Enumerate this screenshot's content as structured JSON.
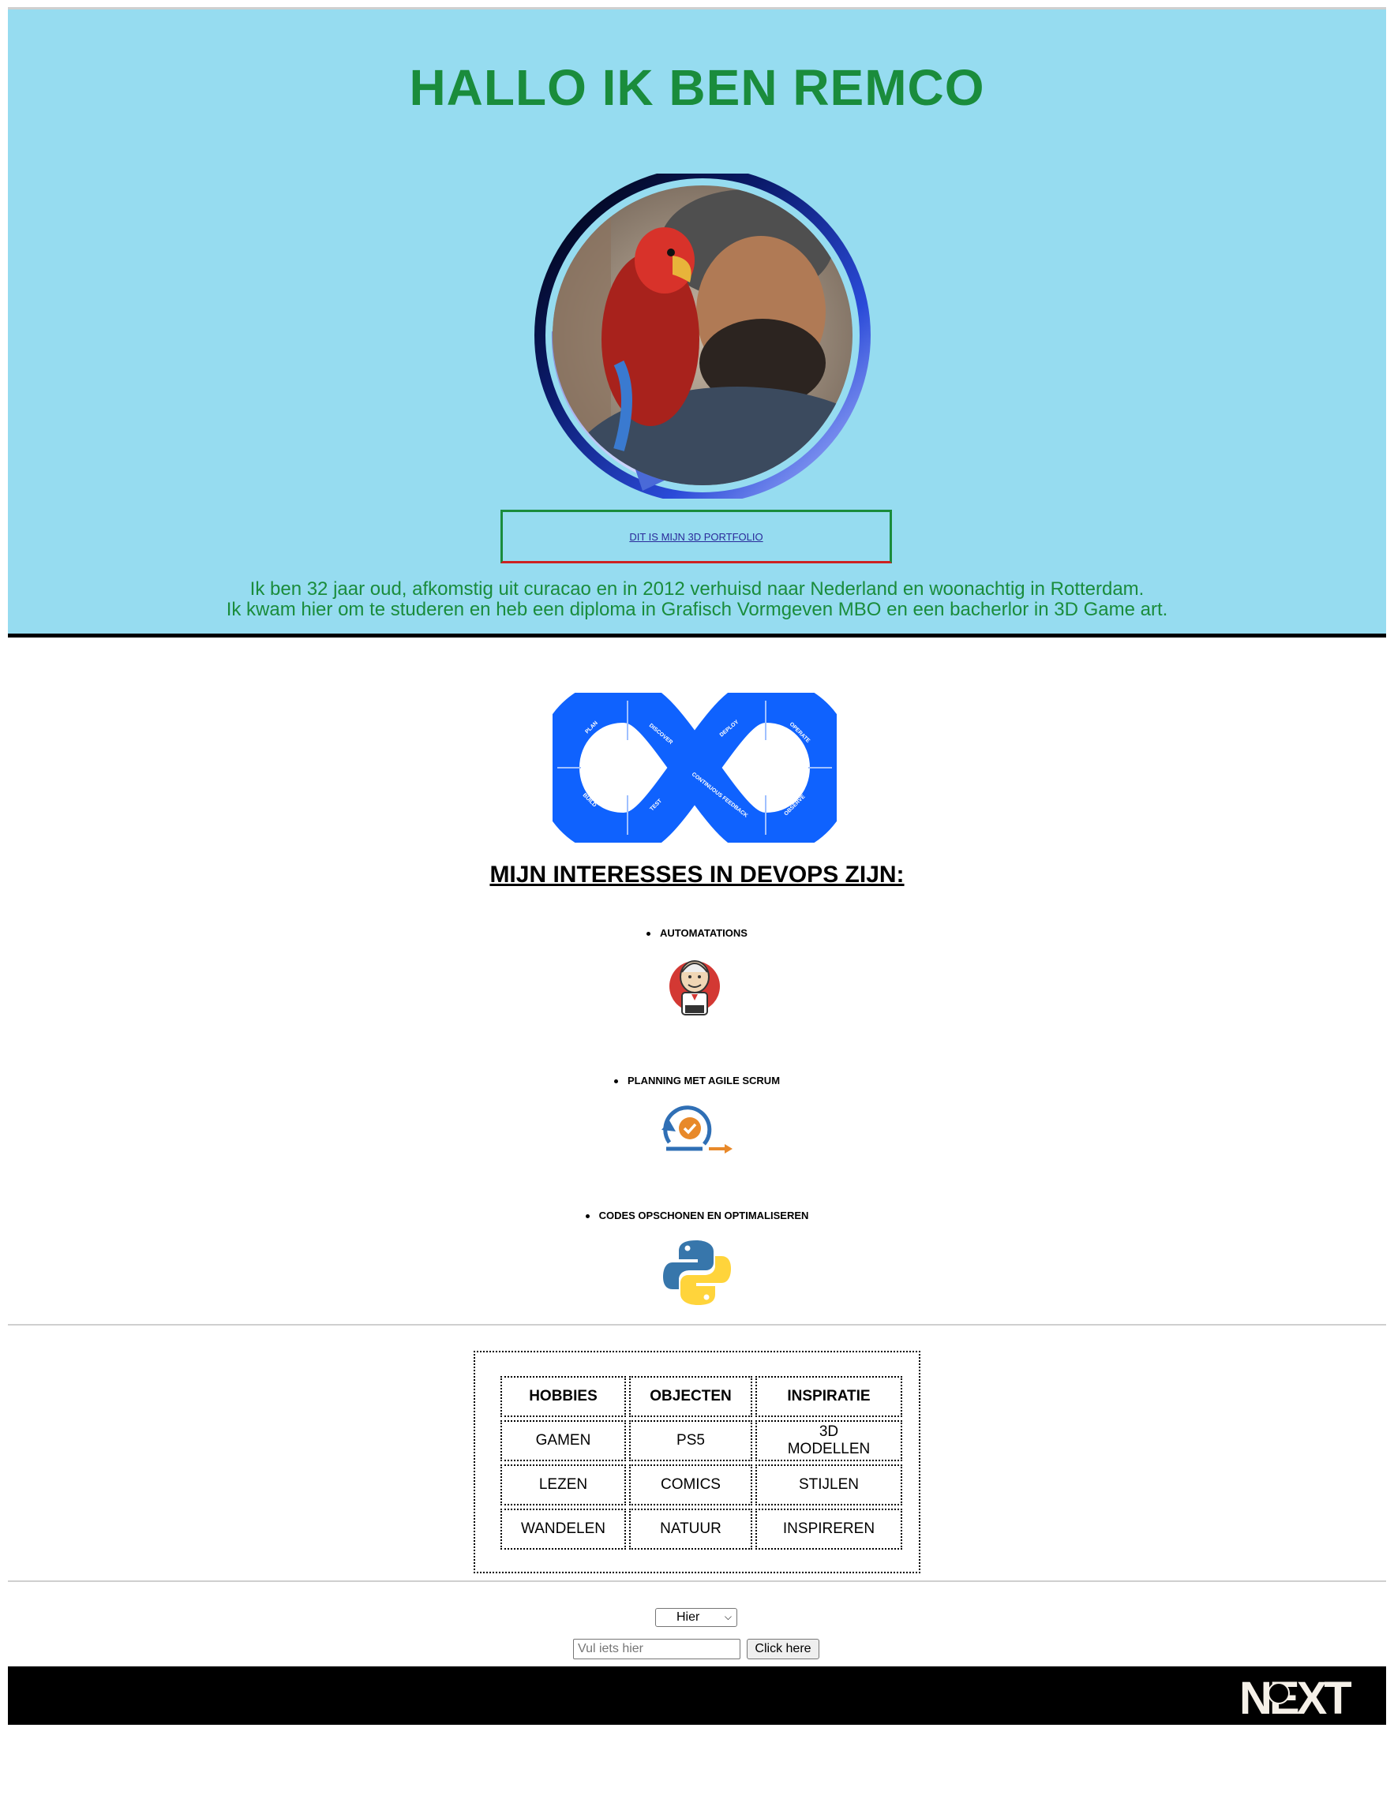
{
  "hero": {
    "title": "HALLO IK BEN REMCO",
    "portfolio_link": "DIT IS MIJN 3D PORTFOLIO",
    "bio_line1": "Ik ben 32 jaar oud, afkomstig uit curacao en in 2012 verhuisd naar Nederland en woonachtig in Rotterdam.",
    "bio_line2": "Ik kwam hier om te studeren en heb een diploma in Grafisch Vormgeven MBO en een bacherlor in 3D Game art."
  },
  "devops": {
    "logo_labels": [
      "PLAN",
      "DISCOVER",
      "DEPLOY",
      "OPERATE",
      "BUILD",
      "TEST",
      "CONTINUOUS FEEDBACK",
      "OBSERVE"
    ],
    "title": "MIJN INTERESSES IN DEVOPS ZIJN:",
    "interests": [
      {
        "label": "AUTOMATATIONS",
        "icon": "jenkins-icon"
      },
      {
        "label": "PLANNING MET AGILE SCRUM",
        "icon": "agile-sprint-icon"
      },
      {
        "label": "CODES OPSCHONEN EN OPTIMALISEREN",
        "icon": "python-icon"
      }
    ]
  },
  "table": {
    "headers": [
      "HOBBIES",
      "OBJECTEN",
      "INSPIRATIE"
    ],
    "rows": [
      [
        "GAMEN",
        "PS5",
        "3D MODELLEN"
      ],
      [
        "LEZEN",
        "COMICS",
        "STIJLEN"
      ],
      [
        "WANDELEN",
        "NATUUR",
        "INSPIREREN"
      ]
    ]
  },
  "form": {
    "select_value": "Hier",
    "input_placeholder": "Vul iets hier",
    "button_label": "Click here"
  },
  "footer": {
    "logo_text": "NEXT"
  },
  "colors": {
    "hero_bg": "#96dcf0",
    "title_green": "#1a8c3c",
    "devops_blue": "#0f62fe",
    "footer_bg": "#000000"
  }
}
